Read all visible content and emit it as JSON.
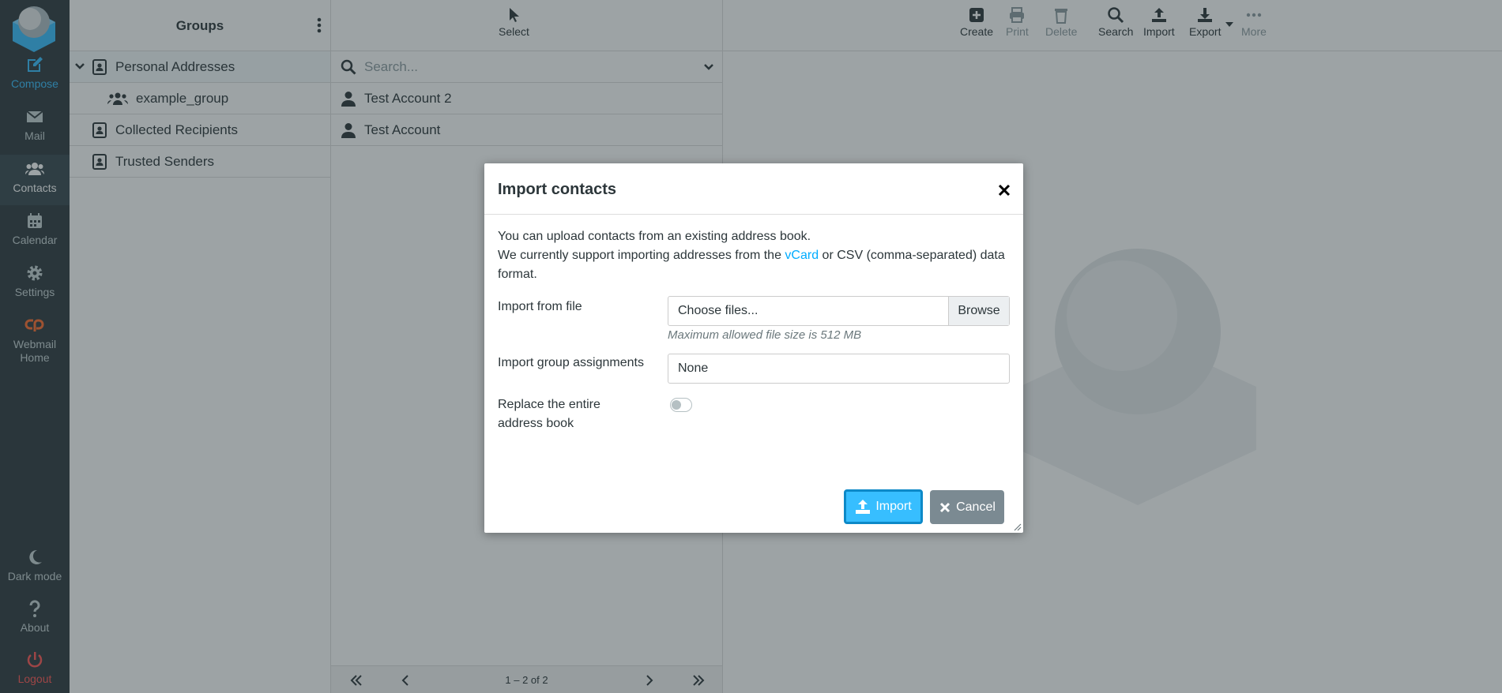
{
  "nav": {
    "items": [
      {
        "label": "Compose",
        "icon": "compose-icon"
      },
      {
        "label": "Mail",
        "icon": "mail-icon"
      },
      {
        "label": "Contacts",
        "icon": "contacts-icon"
      },
      {
        "label": "Calendar",
        "icon": "calendar-icon"
      },
      {
        "label": "Settings",
        "icon": "gear-icon"
      },
      {
        "label_line1": "Webmail",
        "label_line2": "Home",
        "icon": "cpanel-icon"
      }
    ],
    "bottom": [
      {
        "label": "Dark mode",
        "icon": "moon-icon"
      },
      {
        "label": "About",
        "icon": "question-icon"
      },
      {
        "label": "Logout",
        "icon": "power-icon"
      }
    ]
  },
  "groups": {
    "title": "Groups",
    "items": [
      {
        "label": "Personal Addresses"
      },
      {
        "label": "example_group"
      },
      {
        "label": "Collected Recipients"
      },
      {
        "label": "Trusted Senders"
      }
    ]
  },
  "contacts": {
    "toolbar": {
      "select_label": "Select"
    },
    "search_placeholder": "Search...",
    "rows": [
      {
        "name": "Test Account 2"
      },
      {
        "name": "Test Account"
      }
    ],
    "count": "1 – 2 of 2"
  },
  "main_toolbar": {
    "create": "Create",
    "print": "Print",
    "delete": "Delete",
    "search": "Search",
    "import": "Import",
    "export": "Export",
    "more": "More"
  },
  "dialog": {
    "title": "Import contacts",
    "intro_line1": "You can upload contacts from an existing address book.",
    "intro_line2_pre": "We currently support importing addresses from the ",
    "intro_link": "vCard",
    "intro_line2_post": " or CSV (comma-separated) data format.",
    "file_label": "Import from file",
    "file_placeholder": "Choose files...",
    "browse": "Browse",
    "file_hint": "Maximum allowed file size is 512 MB",
    "group_label": "Import group assignments",
    "group_value": "None",
    "replace_label": "Replace the entire address book",
    "replace_on": false,
    "import_btn": "Import",
    "cancel_btn": "Cancel"
  },
  "colors": {
    "nav_bg": "#2f3a3f",
    "accent": "#37beff",
    "logout": "#ff5552",
    "cancel_bg": "#7b8a92"
  }
}
